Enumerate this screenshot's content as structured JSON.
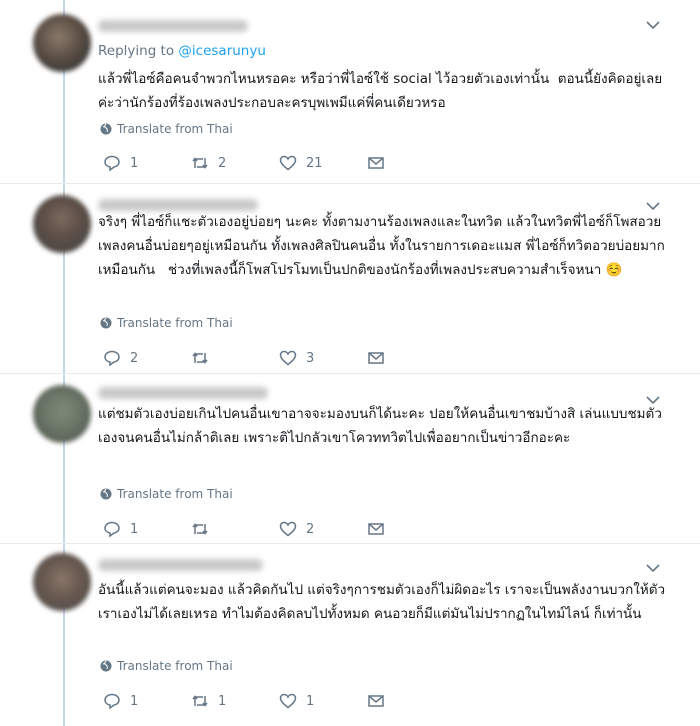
{
  "tweets": [
    {
      "replying_prefix": "Replying to",
      "replying_handle": "@icesarunyu",
      "text": "แล้วพี่ไอซ์คือคนจำพวกไหนหรอคะ หรือว่าพี่ไอซ์ใช้ social ไว้อวยตัวเองเท่านั้น  ตอนนี้ยังคิดอยู่เลยค่ะว่านักร้องที่ร้องเพลงประกอบละครบุพเพมีแค่พี่คนเดียวหรอ",
      "translate": "Translate from Thai",
      "reply_count": "1",
      "retweet_count": "2",
      "like_count": "21"
    },
    {
      "text": "จริงๆ พี่ไอซ์ก็แชะตัวเองอยู่บ่อยๆ นะคะ ทั้งตามงานร้องเพลงและในทวิต แล้วในทวิตพี่ไอซ์ก็โพสอวยเพลงคนอื่นบ่อยๆอยู่เหมือนกัน ทั้งเพลงศิลปินคนอื่น ทั้งในรายการเดอะแมส พี่ไอซ์ก็ทวิตอวยบ่อยมากเหมือนกัน   ช่วงที่เพลงนี้ก็โพสโปรโมทเป็นปกติของนักร้องที่เพลงประสบความสำเร็จหนา ☺️",
      "translate": "Translate from Thai",
      "reply_count": "2",
      "retweet_count": "",
      "like_count": "3"
    },
    {
      "text": "แต่ชมตัวเองบ่อยเกินไปคนอื่นเขาอาจจะมองบนก็ได้นะคะ ปอยให้คนอื่นเขาชมบ้างสิ เล่นแบบชมตัวเองจนคนอื่นไม่กล้าติเลย เพราะติไปกลัวเขาโควททวิตไปเพื่ออยากเป็นข่าวอีกอะคะ",
      "translate": "Translate from Thai",
      "reply_count": "1",
      "retweet_count": "",
      "like_count": "2"
    },
    {
      "text": "อันนี้แล้วแต่คนจะมอง แล้วคิดกันไป แต่จริงๆการชมตัวเองก็ไม่ผิดอะไร เราจะเป็นพลังงานบวกให้ตัวเราเองไม่ได้เลยเหรอ ทำไมต้องคิดลบไปทั้งหมด คนอวยก็มีแต่มันไม่ปรากฏในไทม์ไลน์ ก็เท่านั้น",
      "translate": "Translate from Thai",
      "reply_count": "1",
      "retweet_count": "1",
      "like_count": "1"
    }
  ]
}
